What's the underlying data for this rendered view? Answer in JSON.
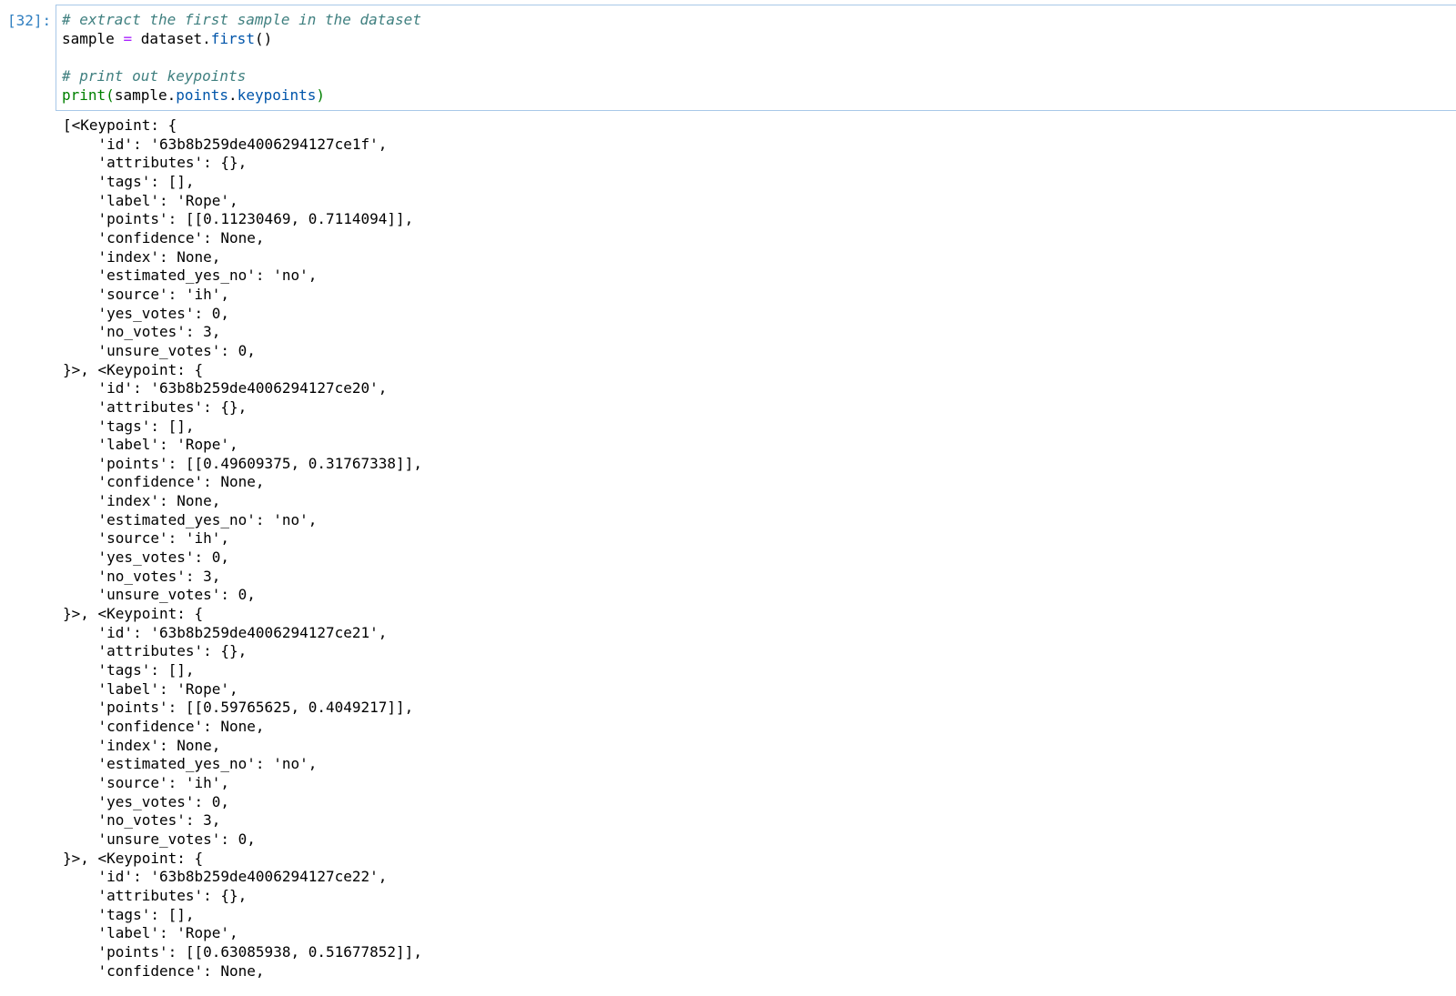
{
  "cell": {
    "prompt": "[32]:",
    "input": {
      "line1_comment": "# extract the first sample in the dataset",
      "line2": {
        "var": "sample",
        "op": "=",
        "obj": "dataset.",
        "method": "first",
        "call": "()"
      },
      "line4_comment": "# print out keypoints",
      "line5": {
        "func": "print",
        "open": "(",
        "obj": "sample.",
        "attr1": "points",
        "dot": ".",
        "attr2": "keypoints",
        "close": ")"
      }
    },
    "output_text": "[<Keypoint: {\n    'id': '63b8b259de4006294127ce1f',\n    'attributes': {},\n    'tags': [],\n    'label': 'Rope',\n    'points': [[0.11230469, 0.7114094]],\n    'confidence': None,\n    'index': None,\n    'estimated_yes_no': 'no',\n    'source': 'ih',\n    'yes_votes': 0,\n    'no_votes': 3,\n    'unsure_votes': 0,\n}>, <Keypoint: {\n    'id': '63b8b259de4006294127ce20',\n    'attributes': {},\n    'tags': [],\n    'label': 'Rope',\n    'points': [[0.49609375, 0.31767338]],\n    'confidence': None,\n    'index': None,\n    'estimated_yes_no': 'no',\n    'source': 'ih',\n    'yes_votes': 0,\n    'no_votes': 3,\n    'unsure_votes': 0,\n}>, <Keypoint: {\n    'id': '63b8b259de4006294127ce21',\n    'attributes': {},\n    'tags': [],\n    'label': 'Rope',\n    'points': [[0.59765625, 0.4049217]],\n    'confidence': None,\n    'index': None,\n    'estimated_yes_no': 'no',\n    'source': 'ih',\n    'yes_votes': 0,\n    'no_votes': 3,\n    'unsure_votes': 0,\n}>, <Keypoint: {\n    'id': '63b8b259de4006294127ce22',\n    'attributes': {},\n    'tags': [],\n    'label': 'Rope',\n    'points': [[0.63085938, 0.51677852]],\n    'confidence': None,"
  },
  "colors": {
    "prompt": "#307fc1",
    "comment": "#408080",
    "operator": "#aa22ff",
    "attribute": "#0055aa",
    "builtin": "#008000",
    "cell_border": "#a8c8e8"
  }
}
